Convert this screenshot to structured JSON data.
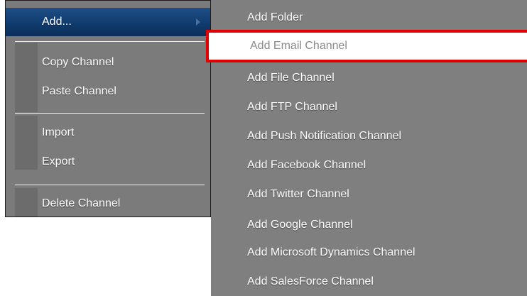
{
  "context_menu": {
    "items": [
      {
        "label": "Add..."
      },
      {
        "label": "Copy Channel"
      },
      {
        "label": "Paste Channel"
      },
      {
        "label": "Import"
      },
      {
        "label": "Export"
      },
      {
        "label": "Delete Channel"
      }
    ],
    "highlight_color": "#0f3a6c"
  },
  "add_submenu": {
    "items": [
      {
        "label": "Add Folder"
      },
      {
        "label": "Add Email Channel",
        "selected": true
      },
      {
        "label": "Add File Channel"
      },
      {
        "label": "Add FTP Channel"
      },
      {
        "label": "Add Push Notification Channel"
      },
      {
        "label": "Add Facebook Channel"
      },
      {
        "label": "Add Twitter Channel"
      },
      {
        "label": "Add Google Channel"
      },
      {
        "label": "Add Microsoft Dynamics Channel"
      },
      {
        "label": "Add SalesForce Channel"
      }
    ],
    "selection_outline_color": "#e00000"
  }
}
